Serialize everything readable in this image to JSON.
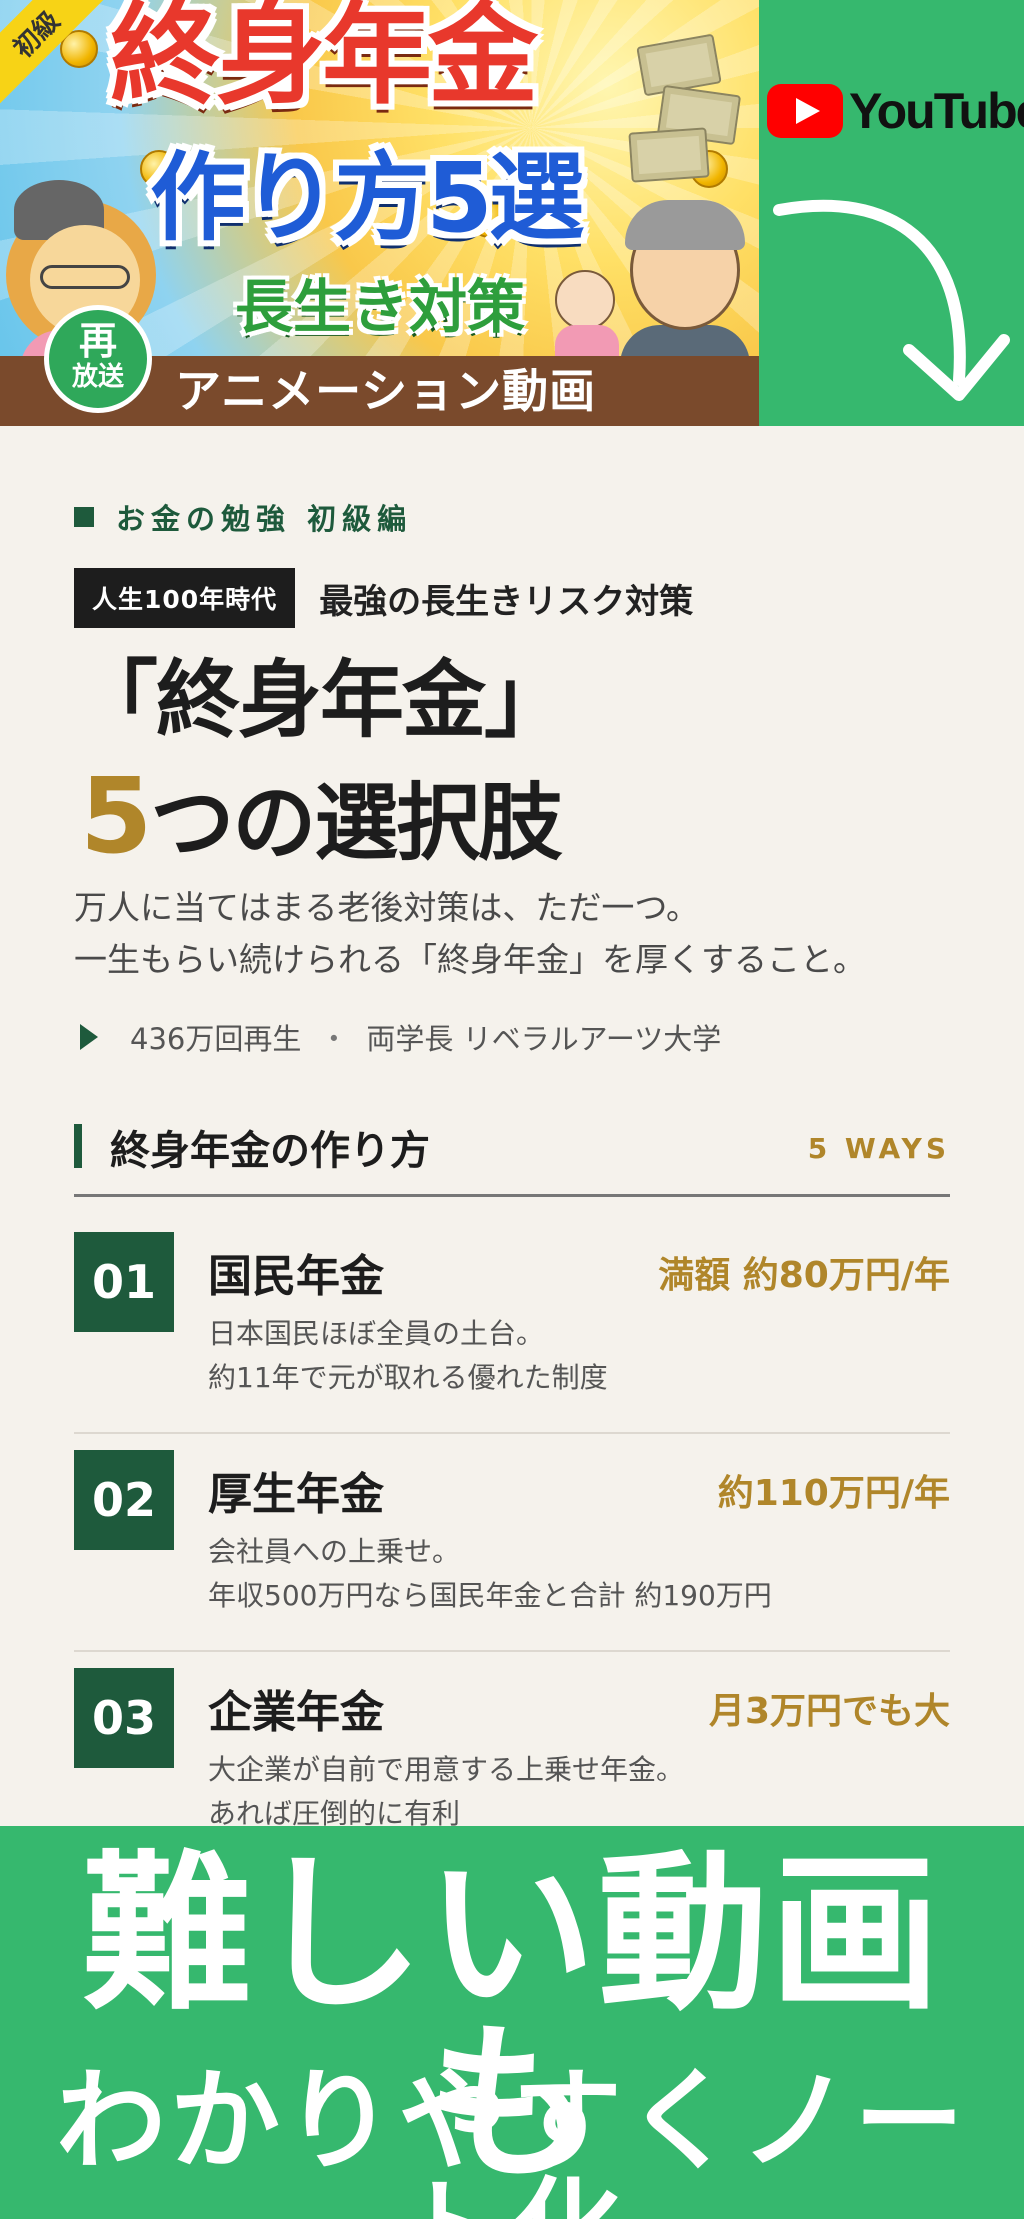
{
  "thumbnail": {
    "corner_badge": "初級",
    "title_line1": "終身年金",
    "title_line2": "作り方5選",
    "title_line3": "長生き対策",
    "replay_badge_line1": "再",
    "replay_badge_line2": "放送",
    "bottom_bar_text": "アニメーション動画"
  },
  "youtube_panel": {
    "logo_text": "YouTube",
    "brand_color": "#ff0000",
    "panel_color": "#36b86e",
    "arrow_icon": "curved-arrow-down-icon"
  },
  "article": {
    "category": "お金の勉強 初級編",
    "tag_box": "人生100年時代",
    "tagline": "最強の長生きリスク対策",
    "headline_line1": "「終身年金」",
    "headline_number": "5",
    "headline_line2_rest": "つの選択肢",
    "lead_line1": "万人に当てはまる老後対策は、ただ一つ。",
    "lead_line2": "一生もらい続けられる「終身年金」を厚くすること。",
    "meta_views": "436万回再生",
    "meta_separator": "・",
    "meta_author": "両学長 リベラルアーツ大学",
    "section_title": "終身年金の作り方",
    "section_ways": "5 WAYS",
    "accent_color": "#b0862a",
    "primary_color": "#1e5a3c",
    "items": [
      {
        "number": "01",
        "title": "国民年金",
        "amount": "満額 約80万円/年",
        "desc_line1": "日本国民ほぼ全員の土台。",
        "desc_line2": "約11年で元が取れる優れた制度"
      },
      {
        "number": "02",
        "title": "厚生年金",
        "amount": "約110万円/年",
        "desc_line1": "会社員への上乗せ。",
        "desc_line2": "年収500万円なら国民年金と合計 約190万円"
      },
      {
        "number": "03",
        "title": "企業年金",
        "amount": "月3万円でも大",
        "desc_line1": "大企業が自前で用意する上乗せ年金。",
        "desc_line2": "あれば圧倒的に有利"
      }
    ]
  },
  "banner": {
    "line1": "難しい動画も",
    "line2": "わかりやすくノート化"
  }
}
